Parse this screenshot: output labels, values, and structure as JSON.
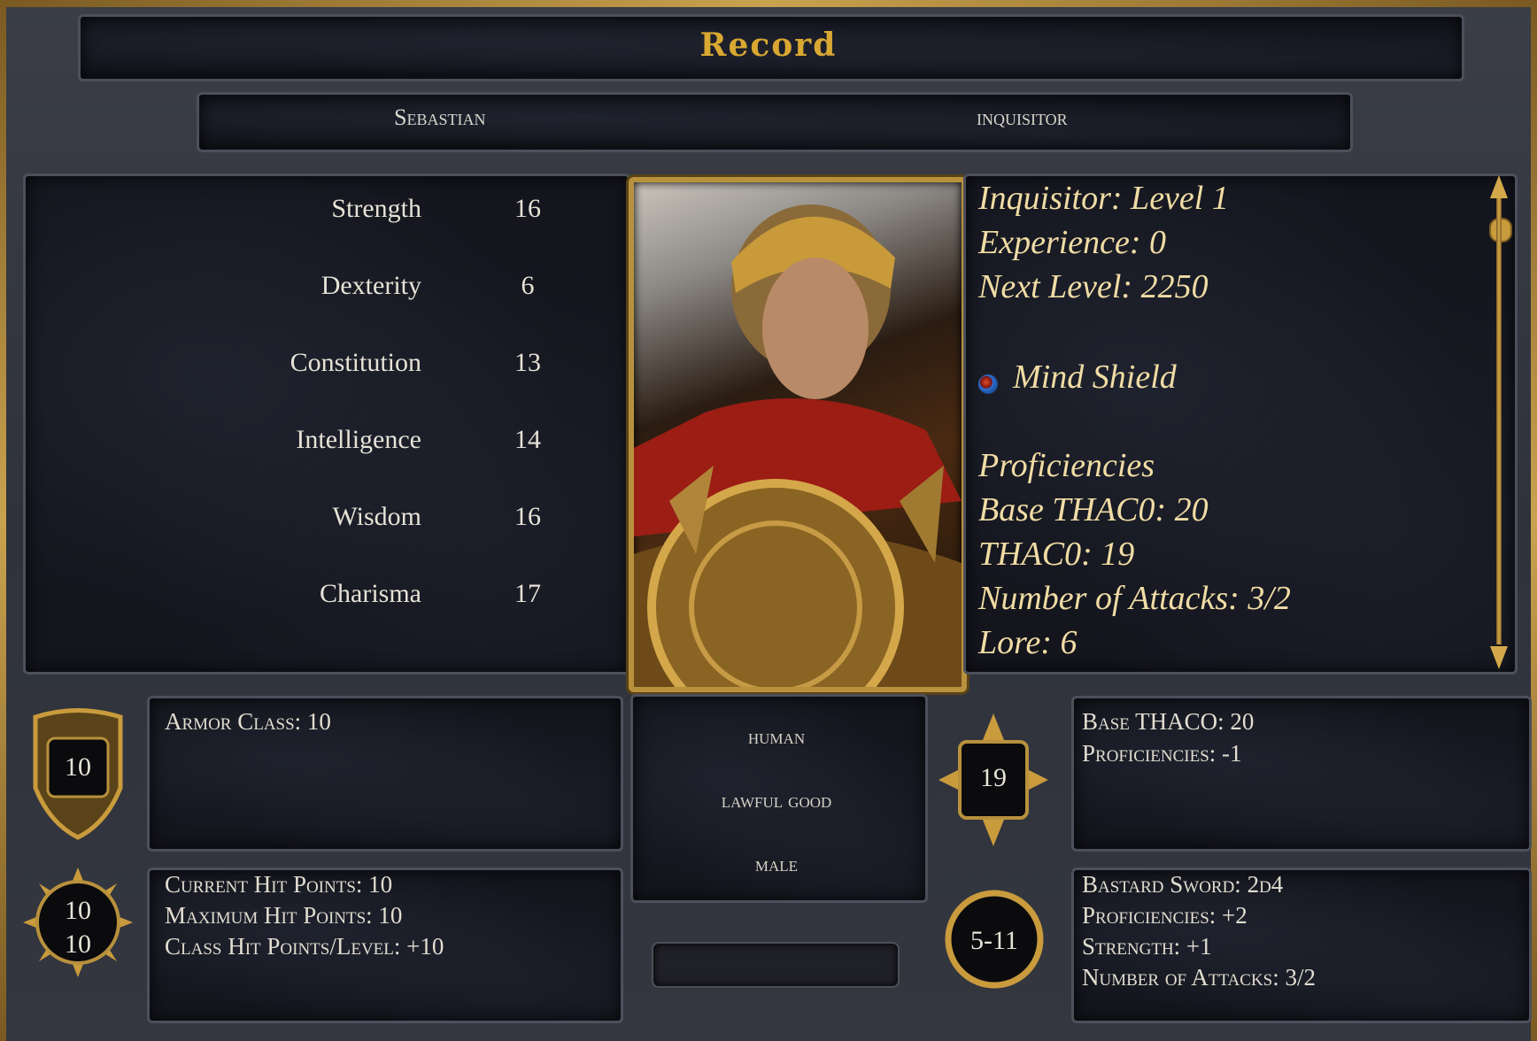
{
  "title": "Record",
  "header": {
    "name": "Sebastian",
    "class": "inquisitor"
  },
  "stats": [
    {
      "label": "Strength",
      "value": "16"
    },
    {
      "label": "Dexterity",
      "value": "6"
    },
    {
      "label": "Constitution",
      "value": "13"
    },
    {
      "label": "Intelligence",
      "value": "14"
    },
    {
      "label": "Wisdom",
      "value": "16"
    },
    {
      "label": "Charisma",
      "value": "17"
    }
  ],
  "info": {
    "level": "Inquisitor: Level 1",
    "experience": "Experience: 0",
    "next_level": "Next Level: 2250",
    "ability": "Mind Shield",
    "proficiencies": "Proficiencies",
    "base_thac0": "Base THAC0: 20",
    "thac0": "THAC0: 19",
    "attacks": "Number of Attacks: 3/2",
    "lore": "Lore: 6"
  },
  "armor": {
    "icon_value": "10",
    "text": "Armor Class: 10"
  },
  "hp": {
    "current_icon": "10",
    "max_icon": "10",
    "current": "Current Hit Points: 10",
    "maximum": "Maximum Hit Points: 10",
    "per_level": "Class Hit Points/Level: +10"
  },
  "identity": {
    "race": "human",
    "alignment": "lawful good",
    "gender": "male"
  },
  "thac0_box": {
    "icon_value": "19",
    "line1": "Base THACO: 20",
    "line2": "Proficiencies: -1"
  },
  "weapon": {
    "icon_value": "5-11",
    "line1": "Bastard Sword: 2d4",
    "line2": "Proficiencies: +2",
    "line3": "Strength: +1",
    "line4": "Number of Attacks: 3/2"
  },
  "icons": {
    "ability": "gem-icon",
    "armor": "shield-icon",
    "hp": "sun-icon",
    "thac0": "compass-star-icon",
    "damage": "ring-icon"
  }
}
